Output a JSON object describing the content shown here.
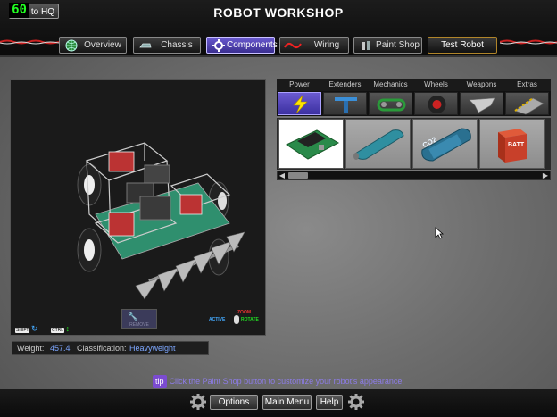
{
  "hud": {
    "fps": "60"
  },
  "header": {
    "back_label": "to HQ",
    "title": "ROBOT WORKSHOP",
    "tabs": [
      {
        "label": "Overview",
        "icon": "globe-icon"
      },
      {
        "label": "Chassis",
        "icon": "chassis-icon"
      },
      {
        "label": "Components",
        "icon": "gear-icon",
        "active": true
      },
      {
        "label": "Wiring",
        "icon": "wire-icon"
      },
      {
        "label": "Paint Shop",
        "icon": "paint-icon"
      },
      {
        "label": "Test Robot"
      }
    ]
  },
  "viewport": {
    "shift_key": "SHIFT",
    "ctrl_key": "CTRL",
    "remove_label": "REMOVE",
    "zoom_label": "ZOOM",
    "active_label": "ACTIVE",
    "rotate_label": "ROTATE"
  },
  "stats": {
    "weight_label": "Weight:",
    "weight_value": "457.4",
    "class_label": "Classification:",
    "class_value": "Heavyweight"
  },
  "components": {
    "categories": [
      "Power",
      "Extenders",
      "Mechanics",
      "Wheels",
      "Weapons",
      "Extras"
    ],
    "active_category": "Power",
    "items": [
      {
        "icon": "battery-board-icon",
        "selected": true
      },
      {
        "icon": "cylinder-battery-icon"
      },
      {
        "icon": "cell-battery-icon",
        "label": "CO2"
      },
      {
        "icon": "box-battery-icon",
        "label": "BATT"
      }
    ]
  },
  "tip": {
    "badge": "tip",
    "text": "Click the Paint Shop button to customize your robot's appearance."
  },
  "footer": {
    "buttons": [
      "Options",
      "Main Menu",
      "Help"
    ]
  },
  "colors": {
    "accent": "#6a5ad0",
    "tip_text": "#8d7ce8",
    "fps": "#22ff22",
    "value": "#7da7ff"
  }
}
